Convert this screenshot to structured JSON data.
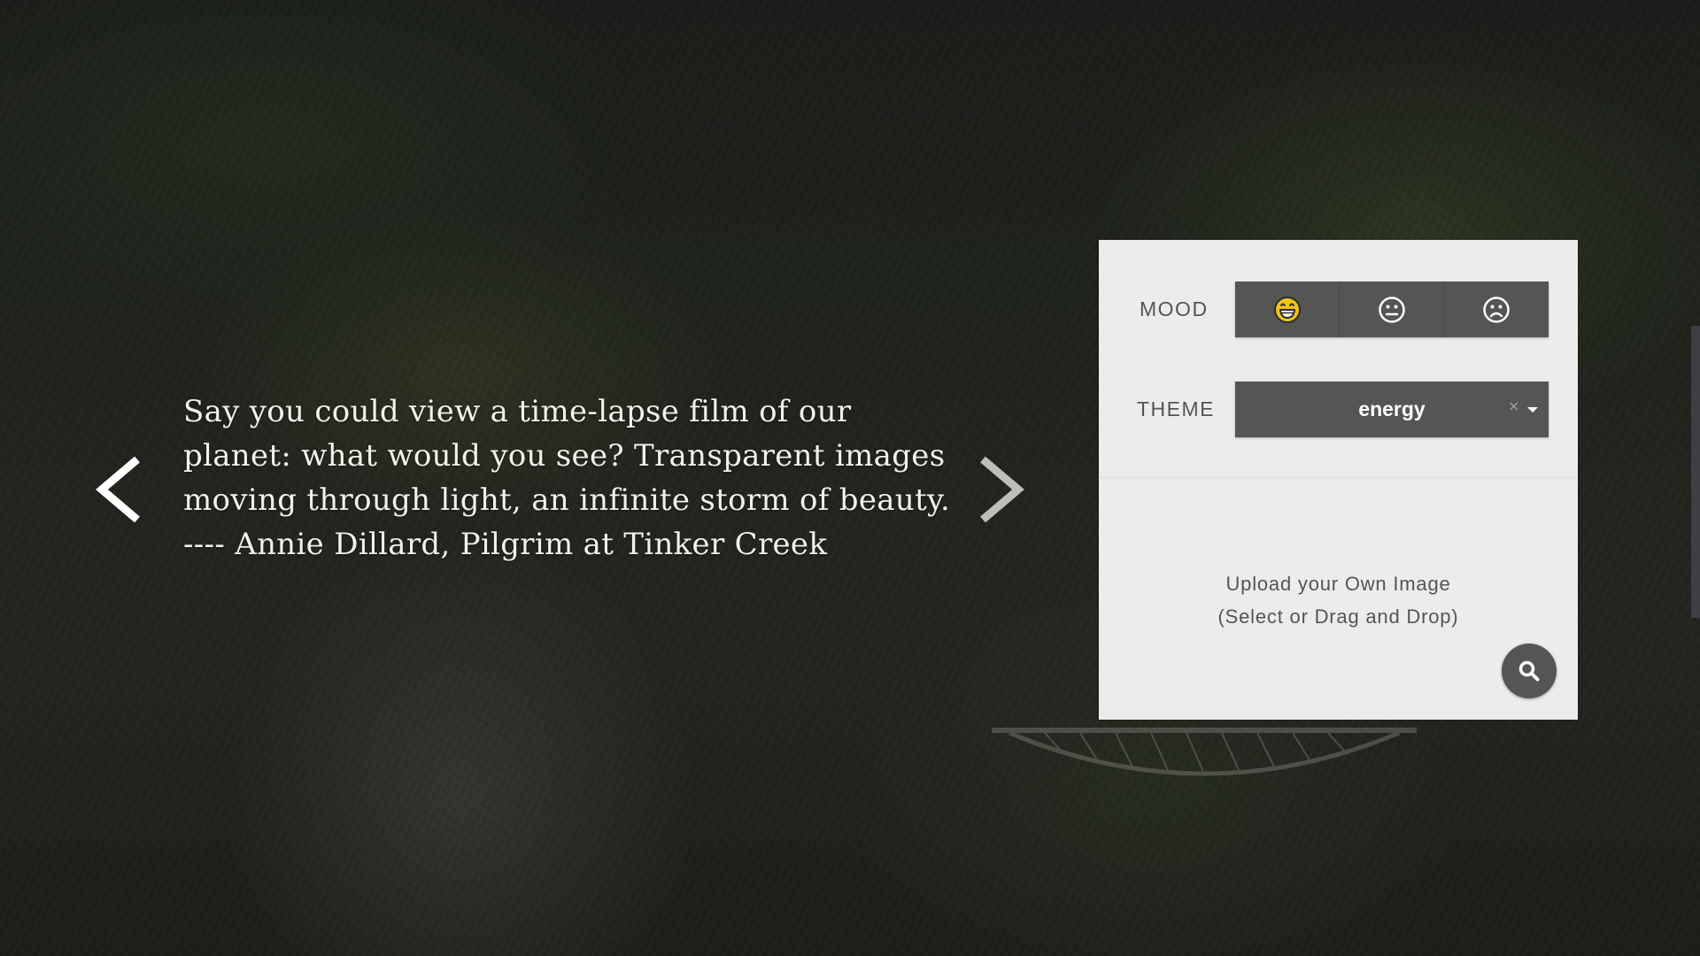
{
  "quote": {
    "text": "Say you could view a time-lapse film of our planet: what would you see? Transparent images moving through light, an infinite storm of beauty. ---- Annie Dillard, Pilgrim at Tinker Creek"
  },
  "carousel": {
    "prev_icon": "chevron-left-icon",
    "next_icon": "chevron-right-icon"
  },
  "panel": {
    "mood": {
      "label": "MOOD",
      "options": [
        {
          "icon": "grinning-face-icon",
          "selected": true
        },
        {
          "icon": "neutral-face-icon",
          "selected": false
        },
        {
          "icon": "sad-face-icon",
          "selected": false
        }
      ]
    },
    "theme": {
      "label": "THEME",
      "value": "energy",
      "clear_glyph": "×"
    },
    "upload": {
      "line1": "Upload your Own Image",
      "line2": "(Select or Drag and Drop)"
    },
    "search_icon": "search-icon"
  },
  "colors": {
    "panel_bg": "#ececec",
    "control_bg": "#555553",
    "selected_emoji": "#f3c21a",
    "quote_text": "#f4f1ea"
  }
}
